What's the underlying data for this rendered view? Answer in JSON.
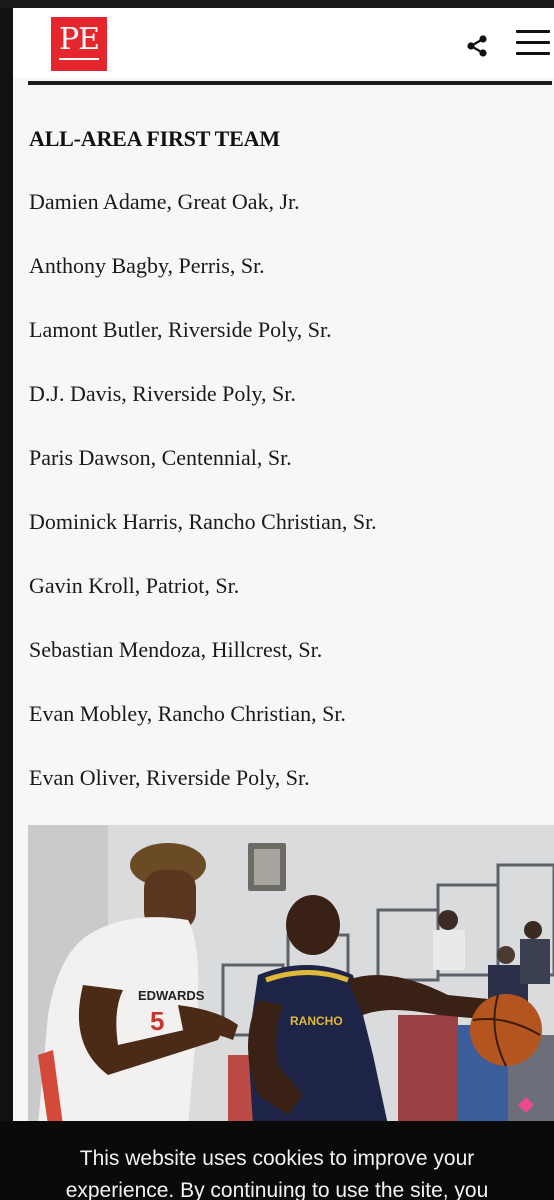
{
  "header": {
    "logo_text": "PE",
    "brand_color": "#e5272d",
    "share_icon": "share-icon",
    "menu_icon": "hamburger-menu-icon"
  },
  "article": {
    "section_title": "ALL-AREA FIRST TEAM",
    "players": [
      "Damien Adame, Great Oak, Jr.",
      "Anthony Bagby, Perris, Sr.",
      "Lamont Butler, Riverside Poly, Sr.",
      "D.J. Davis, Riverside Poly, Sr.",
      "Paris Dawson, Centennial, Sr.",
      "Dominick Harris, Rancho Christian, Sr.",
      "Gavin Kroll, Patriot, Sr.",
      "Sebastian Mendoza, Hillcrest, Sr.",
      "Evan Mobley, Rancho Christian, Sr.",
      "Evan Oliver, Riverside Poly, Sr."
    ]
  },
  "photo": {
    "jersey_left_text": "EDWARDS",
    "jersey_left_number": "5",
    "jersey_right_text": "RANCHO"
  },
  "cookie_banner": {
    "line1": "This website uses cookies to improve your",
    "line2": "experience. By continuing to use the site, you"
  }
}
